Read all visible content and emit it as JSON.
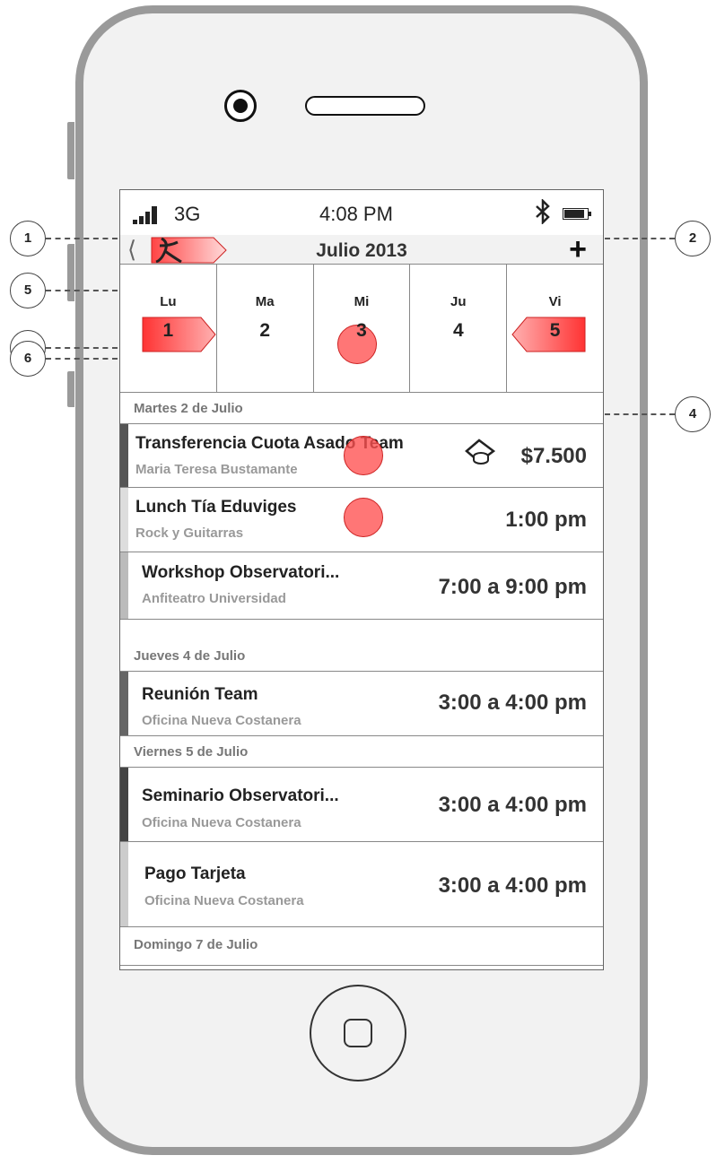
{
  "status_bar": {
    "network": "3G",
    "time": "4:08 PM"
  },
  "nav_bar": {
    "back_icon": "chevron-left-icon",
    "title": "Julio 2013",
    "add_icon": "plus-icon"
  },
  "week": {
    "days": [
      {
        "name": "Lu",
        "number": "1"
      },
      {
        "name": "Ma",
        "number": "2"
      },
      {
        "name": "Mi",
        "number": "3"
      },
      {
        "name": "Ju",
        "number": "4"
      },
      {
        "name": "Vi",
        "number": "5"
      }
    ]
  },
  "sections": [
    {
      "header": "Martes 2 de Julio",
      "events": [
        {
          "title": "Transferencia Cuota Asado Team",
          "subtitle": "Maria Teresa Bustamante",
          "value": "$7.500",
          "icon": "payment-icon",
          "bar_color": "#555555"
        },
        {
          "title": "Lunch Tía Eduviges",
          "subtitle": "Rock y Guitarras",
          "value": "1:00 pm",
          "bar_color": "#dddddd"
        },
        {
          "title": "Workshop Observatori...",
          "subtitle": "Anfiteatro Universidad",
          "value": "7:00 a 9:00 pm",
          "bar_color": "#bbbbbb"
        }
      ]
    },
    {
      "header": "Jueves 4 de Julio",
      "events": [
        {
          "title": "Reunión Team",
          "subtitle": "Oficina Nueva Costanera",
          "value": "3:00 a 4:00 pm",
          "bar_color": "#666666"
        }
      ]
    },
    {
      "header": "Viernes 5 de Julio",
      "events": [
        {
          "title": "Seminario Observatori...",
          "subtitle": "Oficina Nueva Costanera",
          "value": "3:00 a 4:00 pm",
          "bar_color": "#444444"
        },
        {
          "title": "Pago Tarjeta",
          "subtitle": "Oficina Nueva Costanera",
          "value": "3:00 a 4:00 pm",
          "bar_color": "#cccccc"
        }
      ]
    },
    {
      "header": "Domingo 7 de Julio",
      "events": []
    }
  ],
  "callouts": [
    "1",
    "2",
    "3",
    "4",
    "5",
    "6"
  ],
  "colors": {
    "accent_red": "#ff5050",
    "frame": "#9a9a9a",
    "screen_bg": "#f2f2f2"
  }
}
